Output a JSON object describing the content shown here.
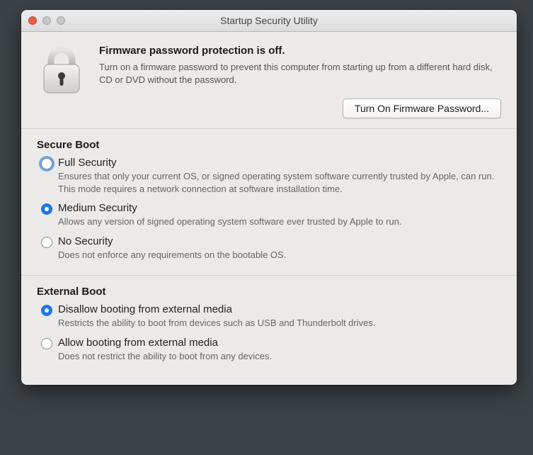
{
  "window": {
    "title": "Startup Security Utility"
  },
  "firmware": {
    "heading": "Firmware password protection is off.",
    "description": "Turn on a firmware password to prevent this computer from starting up from a different hard disk, CD or DVD without the password.",
    "button_label": "Turn On Firmware Password..."
  },
  "secure_boot": {
    "heading": "Secure Boot",
    "options": [
      {
        "label": "Full Security",
        "description": "Ensures that only your current OS, or signed operating system software currently trusted by Apple, can run. This mode requires a network connection at software installation time.",
        "selected": false,
        "focused": true
      },
      {
        "label": "Medium Security",
        "description": "Allows any version of signed operating system software ever trusted by Apple to run.",
        "selected": true,
        "focused": false
      },
      {
        "label": "No Security",
        "description": "Does not enforce any requirements on the bootable OS.",
        "selected": false,
        "focused": false
      }
    ]
  },
  "external_boot": {
    "heading": "External Boot",
    "options": [
      {
        "label": "Disallow booting from external media",
        "description": "Restricts the ability to boot from devices such as USB and Thunderbolt drives.",
        "selected": true
      },
      {
        "label": "Allow booting from external media",
        "description": "Does not restrict the ability to boot from any devices.",
        "selected": false
      }
    ]
  }
}
